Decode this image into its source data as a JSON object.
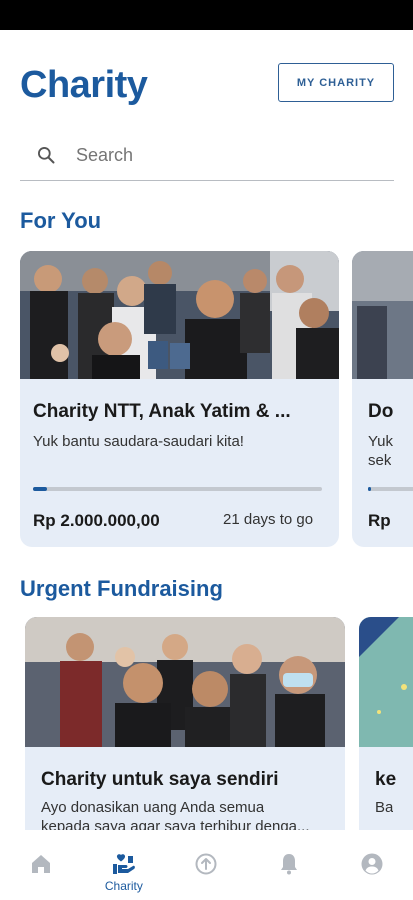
{
  "header": {
    "title": "Charity",
    "my_charity_label": "MY CHARITY"
  },
  "search": {
    "placeholder": "Search"
  },
  "for_you": {
    "title": "For You",
    "cards": [
      {
        "title": "Charity NTT, Anak Yatim & ...",
        "subtitle": "Yuk bantu saudara-saudari kita!",
        "amount": "Rp 2.000.000,00",
        "days_left": "21 days to go",
        "progress": 0.05
      },
      {
        "title": "Do",
        "subtitle": "Yuk",
        "subtitle2": "sek",
        "amount": "Rp",
        "progress": 0.05
      }
    ]
  },
  "urgent": {
    "title": "Urgent Fundraising",
    "cards": [
      {
        "title": "Charity untuk saya sendiri",
        "subtitle": "Ayo donasikan uang Anda semua",
        "subtitle2": "kepada saya agar saya terhibur denga..."
      },
      {
        "title": "ke",
        "subtitle": "Ba"
      }
    ]
  },
  "nav": {
    "items": [
      {
        "icon": "home-icon",
        "label": ""
      },
      {
        "icon": "charity-icon",
        "label": "Charity",
        "active": true
      },
      {
        "icon": "add-circle-icon",
        "label": ""
      },
      {
        "icon": "bell-icon",
        "label": ""
      },
      {
        "icon": "account-icon",
        "label": ""
      }
    ]
  },
  "colors": {
    "accent": "#1c5a9e",
    "card_bg": "#e6edf7",
    "inactive_icon": "#b3b8bf"
  }
}
